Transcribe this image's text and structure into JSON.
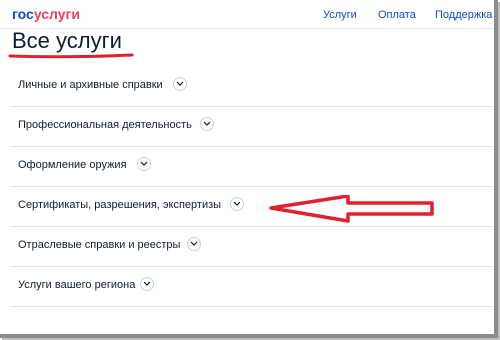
{
  "header": {
    "logo_part1": "гос",
    "logo_part2": "услуги",
    "nav": [
      "Услуги",
      "Оплата",
      "Поддержка"
    ]
  },
  "page": {
    "title": "Все услуги"
  },
  "categories": [
    "Личные и архивные справки",
    "Профессиональная деятельность",
    "Оформление оружия",
    "Сертификаты, разрешения, экспертизы",
    "Отраслевые справки и реестры",
    "Услуги вашего региона"
  ],
  "colors": {
    "brand_blue": "#0d4cd3",
    "brand_red": "#ee3f58",
    "annotation_red": "#e0202a"
  },
  "icons": {
    "expand": "chevron-down-icon",
    "annotation": "red-arrow-annotation"
  }
}
